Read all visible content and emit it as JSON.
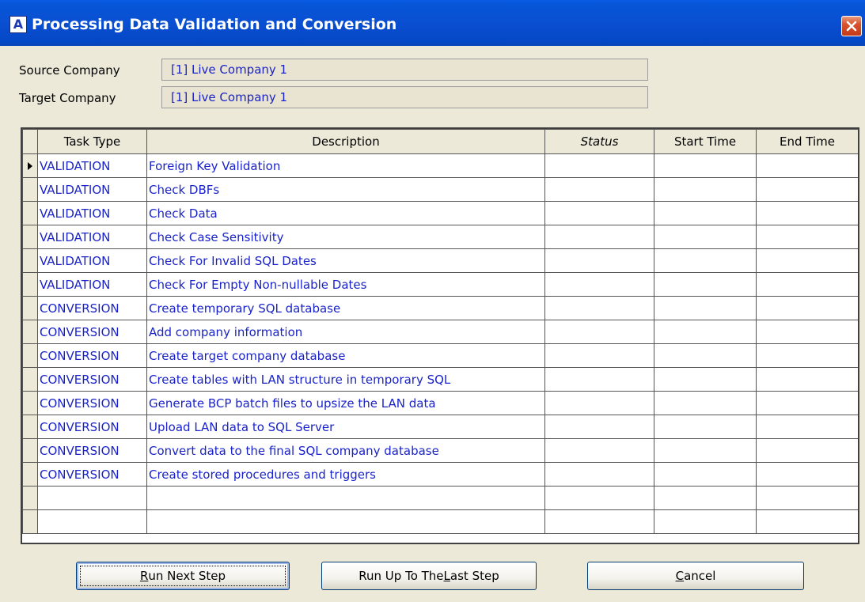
{
  "window": {
    "title": "Processing Data Validation and Conversion",
    "app_icon_letter": "A"
  },
  "form": {
    "source_label": "Source Company",
    "source_value": "[1] Live Company 1",
    "target_label": "Target Company",
    "target_value": "[1] Live Company 1"
  },
  "grid": {
    "columns": [
      "Task Type",
      "Description",
      "Status",
      "Start Time",
      "End Time"
    ],
    "rows": [
      {
        "task_type": "VALIDATION",
        "description": "Foreign Key Validation",
        "status": "",
        "start_time": "",
        "end_time": ""
      },
      {
        "task_type": "VALIDATION",
        "description": "Check DBFs",
        "status": "",
        "start_time": "",
        "end_time": ""
      },
      {
        "task_type": "VALIDATION",
        "description": "Check Data",
        "status": "",
        "start_time": "",
        "end_time": ""
      },
      {
        "task_type": "VALIDATION",
        "description": "Check Case Sensitivity",
        "status": "",
        "start_time": "",
        "end_time": ""
      },
      {
        "task_type": "VALIDATION",
        "description": "Check For Invalid SQL Dates",
        "status": "",
        "start_time": "",
        "end_time": ""
      },
      {
        "task_type": "VALIDATION",
        "description": "Check For Empty Non-nullable Dates",
        "status": "",
        "start_time": "",
        "end_time": ""
      },
      {
        "task_type": "CONVERSION",
        "description": "Create temporary SQL database",
        "status": "",
        "start_time": "",
        "end_time": ""
      },
      {
        "task_type": "CONVERSION",
        "description": "Add company information",
        "status": "",
        "start_time": "",
        "end_time": ""
      },
      {
        "task_type": "CONVERSION",
        "description": "Create target company database",
        "status": "",
        "start_time": "",
        "end_time": ""
      },
      {
        "task_type": "CONVERSION",
        "description": "Create tables with LAN structure in temporary SQL",
        "status": "",
        "start_time": "",
        "end_time": ""
      },
      {
        "task_type": "CONVERSION",
        "description": "Generate BCP batch files to upsize the LAN data",
        "status": "",
        "start_time": "",
        "end_time": ""
      },
      {
        "task_type": "CONVERSION",
        "description": "Upload LAN data to SQL Server",
        "status": "",
        "start_time": "",
        "end_time": ""
      },
      {
        "task_type": "CONVERSION",
        "description": "Convert data to the final SQL company database",
        "status": "",
        "start_time": "",
        "end_time": ""
      },
      {
        "task_type": "CONVERSION",
        "description": "Create stored procedures and triggers",
        "status": "",
        "start_time": "",
        "end_time": ""
      },
      {
        "task_type": "",
        "description": "",
        "status": "",
        "start_time": "",
        "end_time": ""
      },
      {
        "task_type": "",
        "description": "",
        "status": "",
        "start_time": "",
        "end_time": ""
      }
    ]
  },
  "buttons": {
    "run_next_pre": "",
    "run_next_key": "R",
    "run_next_post": "un Next Step",
    "run_all_pre": "Run Up To The ",
    "run_all_key": "L",
    "run_all_post": "ast Step",
    "cancel_pre": "",
    "cancel_key": "C",
    "cancel_post": "ancel"
  },
  "colors": {
    "title_bar": "#0a4fd1",
    "value_text": "#1a23c9",
    "window_bg": "#ece9d8"
  }
}
